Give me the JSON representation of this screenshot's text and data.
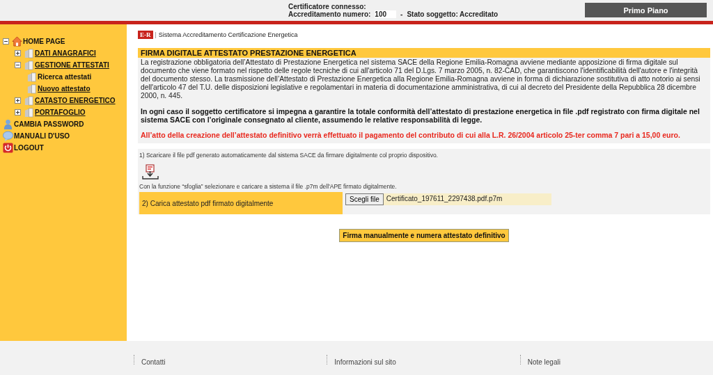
{
  "header": {
    "connected_label": "Certificatore connesso:",
    "accreditation_label": "Accreditamento numero:",
    "accreditation_value": "100",
    "separator": "-",
    "status": "Stato soggetto: Accreditato",
    "button": "Primo Piano"
  },
  "sidebar": {
    "tree": [
      {
        "label": "HOME PAGE",
        "kind": "home",
        "expanded": true,
        "link": false,
        "children": [
          {
            "label": "DATI ANAGRAFICI",
            "kind": "folder",
            "expanded": false,
            "link": true
          },
          {
            "label": "GESTIONE ATTESTATI",
            "kind": "folder",
            "expanded": true,
            "link": true,
            "children": [
              {
                "label": "Ricerca attestati",
                "kind": "folder",
                "link": false
              },
              {
                "label": "Nuovo attestato",
                "kind": "folder",
                "link": true
              }
            ]
          },
          {
            "label": "CATASTO ENERGETICO",
            "kind": "folder",
            "expanded": false,
            "link": true
          },
          {
            "label": "PORTAFOGLIO",
            "kind": "folder",
            "expanded": false,
            "link": true
          }
        ]
      },
      {
        "label": "CAMBIA PASSWORD",
        "kind": "user",
        "link": false
      },
      {
        "label": "MANUALI D'USO",
        "kind": "bubble",
        "link": false
      },
      {
        "label": "LOGOUT",
        "kind": "power",
        "link": false
      }
    ]
  },
  "breadcrumb": {
    "logo": "E-R",
    "separator": "|",
    "title": "Sistema Accreditamento Certificazione Energetica"
  },
  "section": {
    "title": "FIRMA DIGITALE ATTESTATO PRESTAZIONE ENERGETICA",
    "paragraphs": [
      {
        "kind": "normal",
        "text": "La registrazione obbligatoria dell’Attestato di Prestazione Energetica nel sistema SACE della Regione Emilia-Romagna avviene mediante apposizione di firma digitale sul documento che viene formato nel rispetto delle regole tecniche di cui all'articolo 71 del D.Lgs. 7 marzo 2005, n. 82-CAD, che garantiscono l'identificabilità dell'autore e l'integrità del documento stesso. La trasmissione dell’Attestato di Prestazione Energetica alla Regione Emilia-Romagna avviene in forma di dichiarazione sostitutiva di atto notorio ai sensi dell'articolo 47 del T.U. delle disposizioni legislative e regolamentari in materia di documentazione amministrativa, di cui al decreto del Presidente della Repubblica 28 dicembre 2000, n. 445."
      },
      {
        "kind": "bold",
        "text": "In ogni caso il soggetto certificatore si impegna a garantire la totale conformità dell’attestato di prestazione energetica in file .pdf registrato con firma digitale nel sistema SACE con l’originale consegnato al cliente, assumendo le relative responsabilità di legge."
      },
      {
        "kind": "warning",
        "text": "All’atto della creazione dell’attestato definitivo verrà effettuato il pagamento del contributo di cui alla L.R. 26/2004 articolo 25-ter comma 7 pari a 15,00 euro."
      }
    ]
  },
  "upload": {
    "step1": "1) Scaricare il file pdf generato automaticamente dal sistema SACE da firmare digitalmente col proprio dispositivo.",
    "hint": "Con la funzione “sfoglia” selezionare e caricare a sistema il file .p7m dell'APE firmato digitalmente.",
    "step2_label": "2) Carica attestato pdf firmato digitalmente",
    "choose_button": "Scegli file",
    "file_name": "Certificato_197611_2297438.pdf.p7m",
    "submit": "Firma manualmente e numera attestato definitivo"
  },
  "footer": {
    "links": [
      "Contatti",
      "Informazioni sul sito",
      "Note legali"
    ]
  }
}
